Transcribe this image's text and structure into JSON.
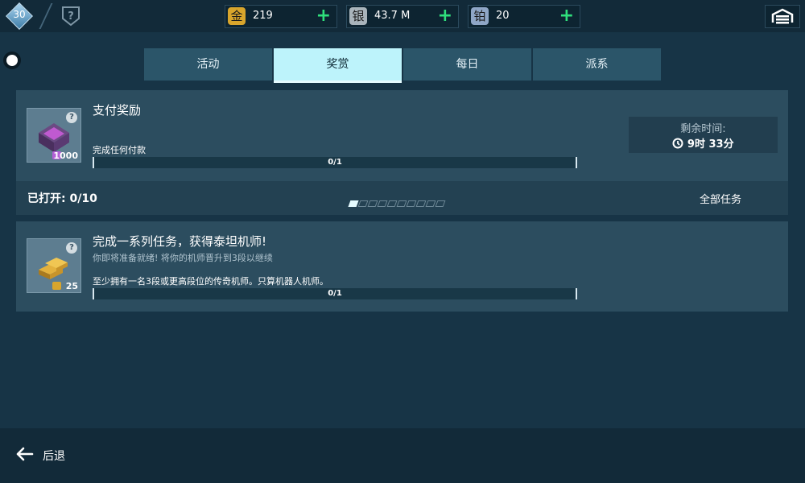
{
  "player": {
    "level": "30"
  },
  "resources": [
    {
      "glyph": "金",
      "value": "219",
      "color": "#d8a52c"
    },
    {
      "glyph": "银",
      "value": "43.7 M",
      "color": "#a9b4bb"
    },
    {
      "glyph": "铂",
      "value": "20",
      "color": "#8fa6c6"
    }
  ],
  "tabs": [
    "活动",
    "奖赏",
    "每日",
    "派系"
  ],
  "active_tab": 1,
  "payment_reward": {
    "title": "支付奖励",
    "task": "完成任何付款",
    "progress_text": "0/1",
    "progress": 0,
    "reward_qty": "1000",
    "timer_label": "剩余时间:",
    "timer_value": "9时 33分"
  },
  "opened": {
    "text": "已打开: 0/10",
    "pages": 10,
    "current_page": 1
  },
  "all_tasks_label": "全部任务",
  "pilot_mission": {
    "title": "完成一系列任务，获得泰坦机师!",
    "subtitle": "你即将准备就绪! 将你的机师晋升到3段以继续",
    "task": "至少拥有一名3段或更高段位的传奇机师。只算机器人机师。",
    "progress_text": "0/1",
    "progress": 0,
    "reward_qty": "25"
  },
  "back_label": "后退",
  "colors": {
    "accent": "#bdf3fb",
    "plus": "#2fe07c",
    "panel": "#2c4d5f"
  }
}
